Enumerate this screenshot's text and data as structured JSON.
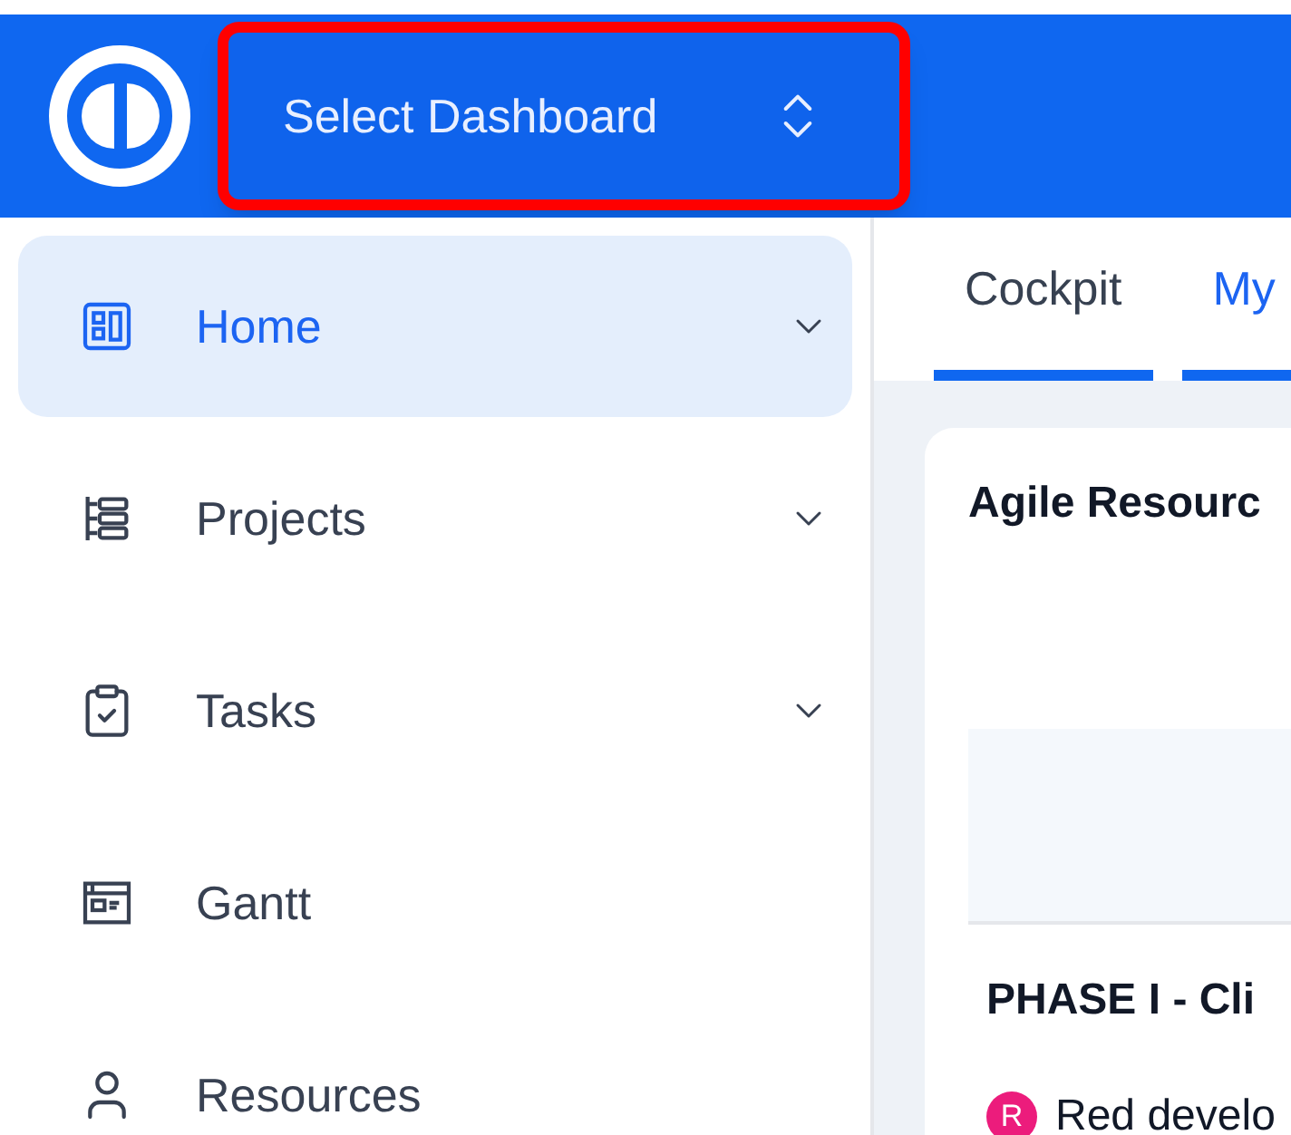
{
  "header": {
    "dashboard_select": {
      "label": "Select Dashboard",
      "highlighted": true
    }
  },
  "sidebar": {
    "items": [
      {
        "label": "Home",
        "selected": true,
        "expandable": true
      },
      {
        "label": "Projects",
        "selected": false,
        "expandable": true
      },
      {
        "label": "Tasks",
        "selected": false,
        "expandable": true
      },
      {
        "label": "Gantt",
        "selected": false,
        "expandable": false
      },
      {
        "label": "Resources",
        "selected": false,
        "expandable": false
      }
    ]
  },
  "tabs": [
    {
      "label": "Cockpit",
      "selected": false
    },
    {
      "label": "My",
      "selected": true
    }
  ],
  "card": {
    "title": "Agile Resourc",
    "section": "PHASE I - Cli",
    "entry": {
      "avatar": "R",
      "color": "#ec1c7c",
      "label": "Red develo"
    }
  }
}
